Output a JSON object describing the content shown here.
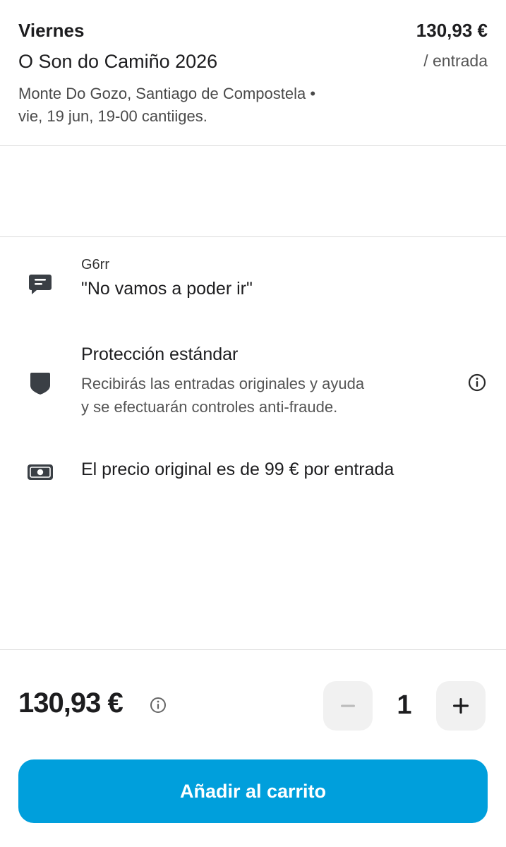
{
  "listing": {
    "day": "Viernes",
    "event_name": "O Son do Camiño 2026",
    "venue_line1": "Monte Do Gozo, Santiago de Compostela •",
    "venue_line2": "vie, 19 jun, 19-00 cantiiges.",
    "price": "130,93 €",
    "per_ticket": "/ entrada"
  },
  "details": {
    "comment_author": "G6rr",
    "comment_text": "\"No vamos a poder ir\"",
    "protection_title": "Protección estándar",
    "protection_desc_line1": "Recibirás las entradas originales y ayuda",
    "protection_desc_line2": "y se efectuarán controles anti-fraude.",
    "original_price": "El precio original es de 99 € por entrada"
  },
  "purchase": {
    "total": "130,93 €",
    "quantity": "1",
    "add_to_cart": "Añadir al carrito"
  },
  "icons": {
    "comment": "chat-bubble-icon",
    "protection": "shield-icon",
    "info": "info-icon",
    "money": "banknote-icon",
    "minus": "minus-icon",
    "plus": "plus-icon"
  },
  "colors": {
    "accent": "#009fdc",
    "stepper_bg": "#f1f1f1",
    "icon": "#3a3f45"
  }
}
